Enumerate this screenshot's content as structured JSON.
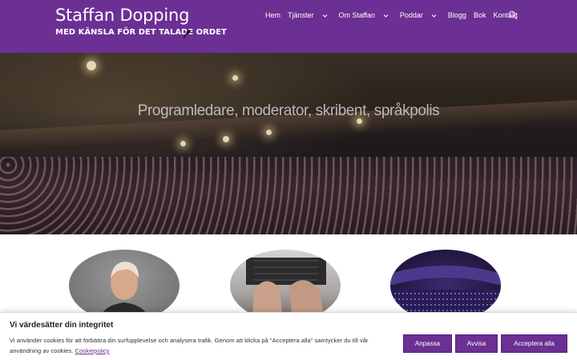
{
  "header": {
    "site_title": "Staffan Dopping",
    "tagline": "MED KÄNSLA FÖR DET TALADE ORDET",
    "background": "#6c2f93",
    "mic_icon": "microphone-icon"
  },
  "nav": {
    "items": [
      {
        "label": "Hem",
        "has_dropdown": false
      },
      {
        "label": "Tjänster",
        "has_dropdown": true
      },
      {
        "label": "Om Staffan",
        "has_dropdown": true
      },
      {
        "label": "Poddar",
        "has_dropdown": true
      },
      {
        "label": "Blogg",
        "has_dropdown": false
      },
      {
        "label": "Bok",
        "has_dropdown": false
      },
      {
        "label": "Kontakt",
        "has_dropdown": false
      }
    ],
    "search_icon": "search-icon"
  },
  "hero": {
    "heading": "Programledare, moderator, skribent, språkpolis"
  },
  "cards": [
    {
      "image": "portrait-photo"
    },
    {
      "image": "keyboard-hands-photo"
    },
    {
      "image": "audience-photo"
    }
  ],
  "cookie": {
    "title": "Vi värdesätter din integritet",
    "text": "Vi använder cookies för att förbättra din surfupplevelse och analysera trafik. Genom att klicka på \"Acceptera alla\" samtycker du till vår användning av cookies.",
    "link": "Cookiepolicy",
    "buttons": {
      "customize": "Anpassa",
      "reject": "Avvisa",
      "accept": "Acceptera alla"
    }
  }
}
